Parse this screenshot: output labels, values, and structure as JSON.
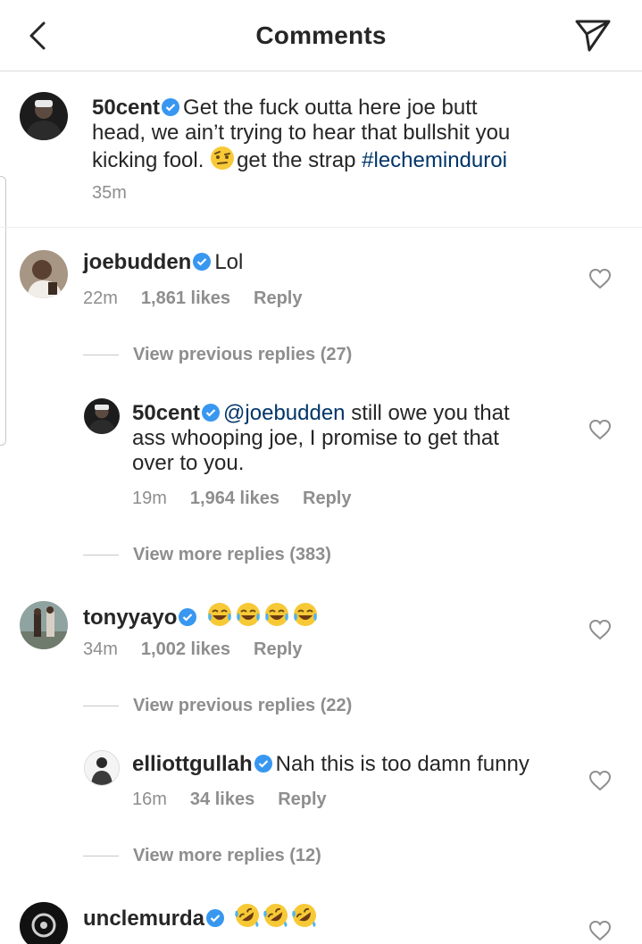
{
  "header": {
    "title": "Comments",
    "back_icon": "chevron-left-icon",
    "send_icon": "paper-plane-icon"
  },
  "colors": {
    "text": "#262626",
    "secondary": "#8e8e8e",
    "link": "#003569",
    "verified": "#3897f0",
    "divider": "#dbdbdb"
  },
  "caption": {
    "username": "50cent",
    "line1": "Get the fuck outta here joe butt",
    "line2": "head, we ain’t trying to hear that bullshit you",
    "line3_pre": "kicking fool.",
    "line3_post": "get the strap",
    "hashtag": "#lecheminduroi",
    "emoji": "face-with-raised-eyebrow-emoji",
    "time": "35m"
  },
  "comments": [
    {
      "username": "joebudden",
      "text": "Lol",
      "time": "22m",
      "likes": "1,861 likes",
      "reply": "Reply",
      "view_replies": "View previous replies (27)",
      "replies": [
        {
          "username": "50cent",
          "mention": "@joebudden",
          "line1": "still owe you that",
          "line2": "ass whooping joe, I promise to get that",
          "line3": "over to you.",
          "time": "19m",
          "likes": "1,964 likes",
          "reply": "Reply"
        }
      ],
      "more_replies": "View more replies (383)"
    },
    {
      "username": "tonyyayo",
      "emoji": "face-with-tears-of-joy-emoji",
      "emoji_count": 4,
      "time": "34m",
      "likes": "1,002 likes",
      "reply": "Reply",
      "view_replies": "View previous replies (22)",
      "replies": [
        {
          "username": "elliottgullah",
          "text": "Nah this is too damn funny",
          "time": "16m",
          "likes": "34 likes",
          "reply": "Reply"
        }
      ],
      "more_replies": "View more replies (12)"
    },
    {
      "username": "unclemurda",
      "emoji": "rolling-on-floor-laughing-emoji",
      "emoji_count": 3
    }
  ]
}
